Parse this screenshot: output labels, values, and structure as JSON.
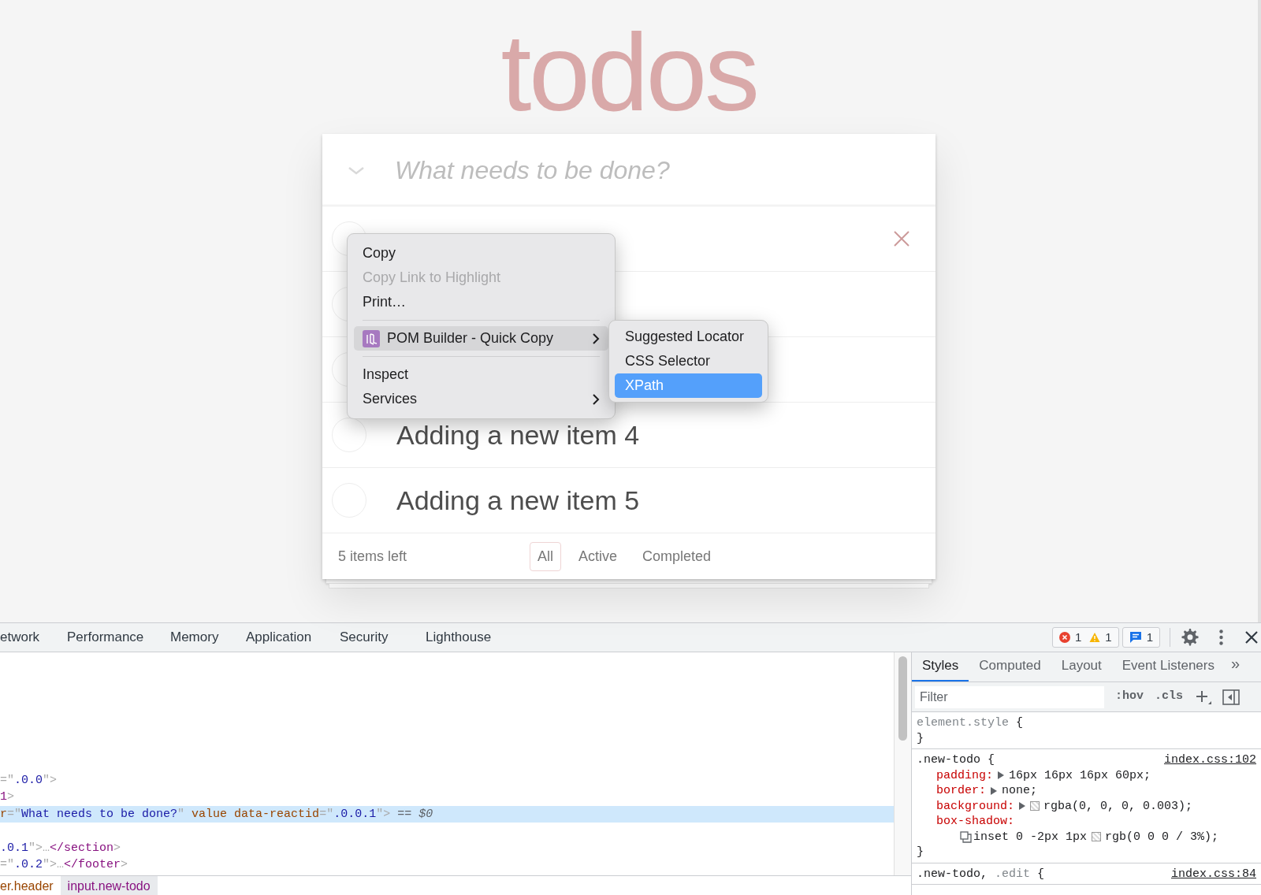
{
  "app": {
    "title": "todos",
    "new_todo_placeholder": "What needs to be done?",
    "items": [
      {
        "completed": false,
        "show_delete": true
      },
      {
        "completed": false,
        "show_delete": false
      },
      {
        "completed": false,
        "show_delete": false
      },
      {
        "text": "Adding a new item 4",
        "completed": false,
        "show_delete": false
      },
      {
        "text": "Adding a new item 5",
        "completed": false,
        "show_delete": false
      }
    ],
    "footer": {
      "count": "5 items left",
      "filters": [
        {
          "label": "All",
          "selected": true
        },
        {
          "label": "Active",
          "selected": false
        },
        {
          "label": "Completed",
          "selected": false
        }
      ]
    }
  },
  "context_menu": {
    "items": [
      {
        "kind": "item",
        "label": "Copy",
        "disabled": false,
        "highlighted": false,
        "has_submenu": false,
        "has_icon": false
      },
      {
        "kind": "item",
        "label": "Copy Link to Highlight",
        "disabled": true,
        "highlighted": false,
        "has_submenu": false,
        "has_icon": false
      },
      {
        "kind": "item",
        "label": "Print…",
        "disabled": false,
        "highlighted": false,
        "has_submenu": false,
        "has_icon": false
      },
      {
        "kind": "separator"
      },
      {
        "kind": "item",
        "label": "POM Builder - Quick Copy",
        "disabled": false,
        "highlighted": true,
        "has_submenu": true,
        "has_icon": true
      },
      {
        "kind": "separator"
      },
      {
        "kind": "item",
        "label": "Inspect",
        "disabled": false,
        "highlighted": false,
        "has_submenu": false,
        "has_icon": false
      },
      {
        "kind": "item",
        "label": "Services",
        "disabled": false,
        "highlighted": false,
        "has_submenu": true,
        "has_icon": false
      }
    ],
    "submenu": [
      {
        "label": "Suggested Locator",
        "selected": false
      },
      {
        "label": "CSS Selector",
        "selected": false
      },
      {
        "label": "XPath",
        "selected": true
      }
    ]
  },
  "devtools": {
    "tabs": [
      {
        "label": "etwork",
        "selected": false
      },
      {
        "label": "Performance",
        "selected": false
      },
      {
        "label": "Memory",
        "selected": false
      },
      {
        "label": "Application",
        "selected": false
      },
      {
        "label": "Security",
        "selected": false
      },
      {
        "label": "Lighthouse",
        "selected": false
      }
    ],
    "counts": {
      "errors": "1",
      "warnings": "1",
      "messages": "1"
    },
    "dom_lines": [
      {
        "selected": false,
        "segments": [
          {
            "kind": "punct",
            "text": "=\""
          },
          {
            "kind": "value",
            "text": ".0.0"
          },
          {
            "kind": "punct",
            "text": "\">"
          }
        ]
      },
      {
        "selected": false,
        "segments": [
          {
            "kind": "tag",
            "text": "1"
          },
          {
            "kind": "punct",
            "text": ">"
          }
        ]
      },
      {
        "selected": true,
        "segments": [
          {
            "kind": "attr",
            "text": "r"
          },
          {
            "kind": "punct",
            "text": "=\""
          },
          {
            "kind": "value",
            "text": "What needs to be done?"
          },
          {
            "kind": "punct",
            "text": "\" "
          },
          {
            "kind": "attr",
            "text": "value data-reactid"
          },
          {
            "kind": "punct",
            "text": "=\""
          },
          {
            "kind": "value",
            "text": ".0.0.1"
          },
          {
            "kind": "punct",
            "text": "\">"
          },
          {
            "kind": "eq",
            "text": " == "
          },
          {
            "kind": "ref",
            "text": "$0"
          }
        ]
      },
      {
        "selected": false
      },
      {
        "selected": false,
        "segments": [
          {
            "kind": "value",
            "text": ".0.1"
          },
          {
            "kind": "punct",
            "text": "\">…"
          },
          {
            "kind": "tag",
            "text": "</section"
          },
          {
            "kind": "punct",
            "text": ">"
          }
        ]
      },
      {
        "selected": false,
        "segments": [
          {
            "kind": "punct",
            "text": "=\""
          },
          {
            "kind": "value",
            "text": ".0.2"
          },
          {
            "kind": "punct",
            "text": "\">…"
          },
          {
            "kind": "tag",
            "text": "</footer"
          },
          {
            "kind": "punct",
            "text": ">"
          }
        ]
      }
    ],
    "breadcrumbs": [
      {
        "label": "er.header",
        "selected": false
      },
      {
        "label": "input.new-todo",
        "selected": true
      }
    ],
    "side_tabs": [
      {
        "label": "Styles",
        "selected": true
      },
      {
        "label": "Computed",
        "selected": false
      },
      {
        "label": "Layout",
        "selected": false
      },
      {
        "label": "Event Listeners",
        "selected": false
      }
    ],
    "more_tabs": "»",
    "filter_placeholder": "Filter",
    "hov": ":hov",
    "cls": ".cls",
    "rules": [
      {
        "selector_parts": [
          {
            "text": "element.style",
            "dim": true
          }
        ],
        "open": "{",
        "close": "}"
      },
      {
        "selector_parts": [
          {
            "text": ".new-todo",
            "dim": false
          }
        ],
        "open": "{",
        "close": "}",
        "source": "index.css:102",
        "declarations": [
          {
            "property": "padding:",
            "parts": [
              {
                "kind": "expand"
              },
              {
                "kind": "text",
                "text": "16px 16px 16px 60px;"
              }
            ]
          },
          {
            "property": "border:",
            "parts": [
              {
                "kind": "expand"
              },
              {
                "kind": "text",
                "text": "none;"
              }
            ]
          },
          {
            "property": "background:",
            "parts": [
              {
                "kind": "expand"
              },
              {
                "kind": "swatch"
              },
              {
                "kind": "text",
                "text": "rgba(0, 0, 0, 0.003);"
              }
            ]
          },
          {
            "property": "box-shadow:",
            "parts": [
              {
                "kind": "break"
              },
              {
                "kind": "shadow"
              },
              {
                "kind": "text",
                "text": "inset 0 -2px 1px"
              },
              {
                "kind": "swatch"
              },
              {
                "kind": "text",
                "text": "rgb(0 0 0 / 3%);"
              }
            ]
          }
        ]
      },
      {
        "selector_parts": [
          {
            "text": ".new-todo,",
            "dim": false
          },
          {
            "text": ".edit",
            "dim": true
          }
        ],
        "open": "{",
        "source": "index.css:84"
      }
    ]
  }
}
